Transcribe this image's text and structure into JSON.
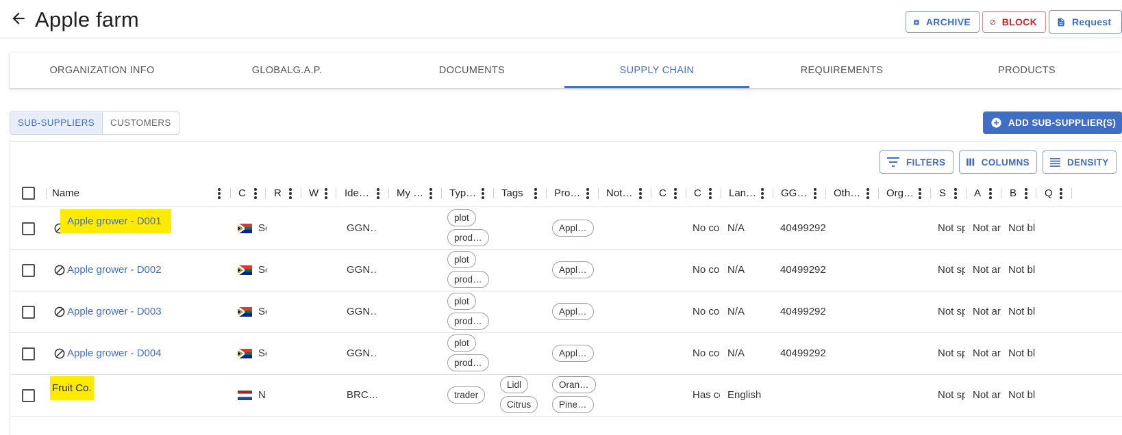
{
  "header": {
    "title": "Apple farm",
    "archive_label": "ARCHIVE",
    "block_label": "BLOCK",
    "request_label": "Request"
  },
  "tabs": [
    "ORGANIZATION INFO",
    "GLOBALG.A.P.",
    "DOCUMENTS",
    "SUPPLY CHAIN",
    "REQUIREMENTS",
    "PRODUCTS"
  ],
  "active_tab": "SUPPLY CHAIN",
  "toggle": {
    "sub_suppliers": "SUB-SUPPLIERS",
    "customers": "CUSTOMERS"
  },
  "add_button": "ADD SUB-SUPPLIER(S)",
  "toolbar": {
    "filters": "FILTERS",
    "columns": "COLUMNS",
    "density": "DENSITY"
  },
  "columns": [
    "Name",
    "C",
    "R",
    "W",
    "Ide…",
    "My …",
    "Typ…",
    "Tags",
    "Pro…",
    "Not…",
    "C",
    "C",
    "Lan…",
    "GG…",
    "Oth…",
    "Org…",
    "S",
    "A",
    "B",
    "Q"
  ],
  "rows": [
    {
      "name": "Apple grower - D001",
      "country": "So",
      "ident": "GGN…",
      "types": [
        "plot",
        "prod…"
      ],
      "tags": [],
      "products": [
        "Appl…"
      ],
      "c2": "No co",
      "language": "N/A",
      "ggn": "40499292",
      "s": "Not sp",
      "a": "Not ar",
      "b": "Not bl"
    },
    {
      "name": "Apple grower - D002",
      "country": "So",
      "ident": "GGN…",
      "types": [
        "plot",
        "prod…"
      ],
      "tags": [],
      "products": [
        "Appl…"
      ],
      "c2": "No co",
      "language": "N/A",
      "ggn": "40499292",
      "s": "Not sp",
      "a": "Not ar",
      "b": "Not bl"
    },
    {
      "name": "Apple grower - D003",
      "country": "So",
      "ident": "GGN…",
      "types": [
        "plot",
        "prod…"
      ],
      "tags": [],
      "products": [
        "Appl…"
      ],
      "c2": "No co",
      "language": "N/A",
      "ggn": "40499292",
      "s": "Not sp",
      "a": "Not ar",
      "b": "Not bl"
    },
    {
      "name": "Apple grower - D004",
      "country": "So",
      "ident": "GGN…",
      "types": [
        "plot",
        "prod…"
      ],
      "tags": [],
      "products": [
        "Appl…"
      ],
      "c2": "No co",
      "language": "N/A",
      "ggn": "40499292",
      "s": "Not sp",
      "a": "Not ar",
      "b": "Not bl"
    },
    {
      "name": "Fruit Co.",
      "country": "N",
      "ident": "BRC…",
      "types": [
        "trader"
      ],
      "tags": [
        "Lidl",
        "Citrus"
      ],
      "products": [
        "Oran…",
        "Pine…"
      ],
      "c2": "Has co",
      "language": "English",
      "ggn": "",
      "s": "Not sp",
      "a": "Not ar",
      "b": "Not bl"
    }
  ],
  "colors": {
    "accent": "#3f6fc4",
    "danger": "#c62828",
    "highlight": "#ffeb00"
  }
}
